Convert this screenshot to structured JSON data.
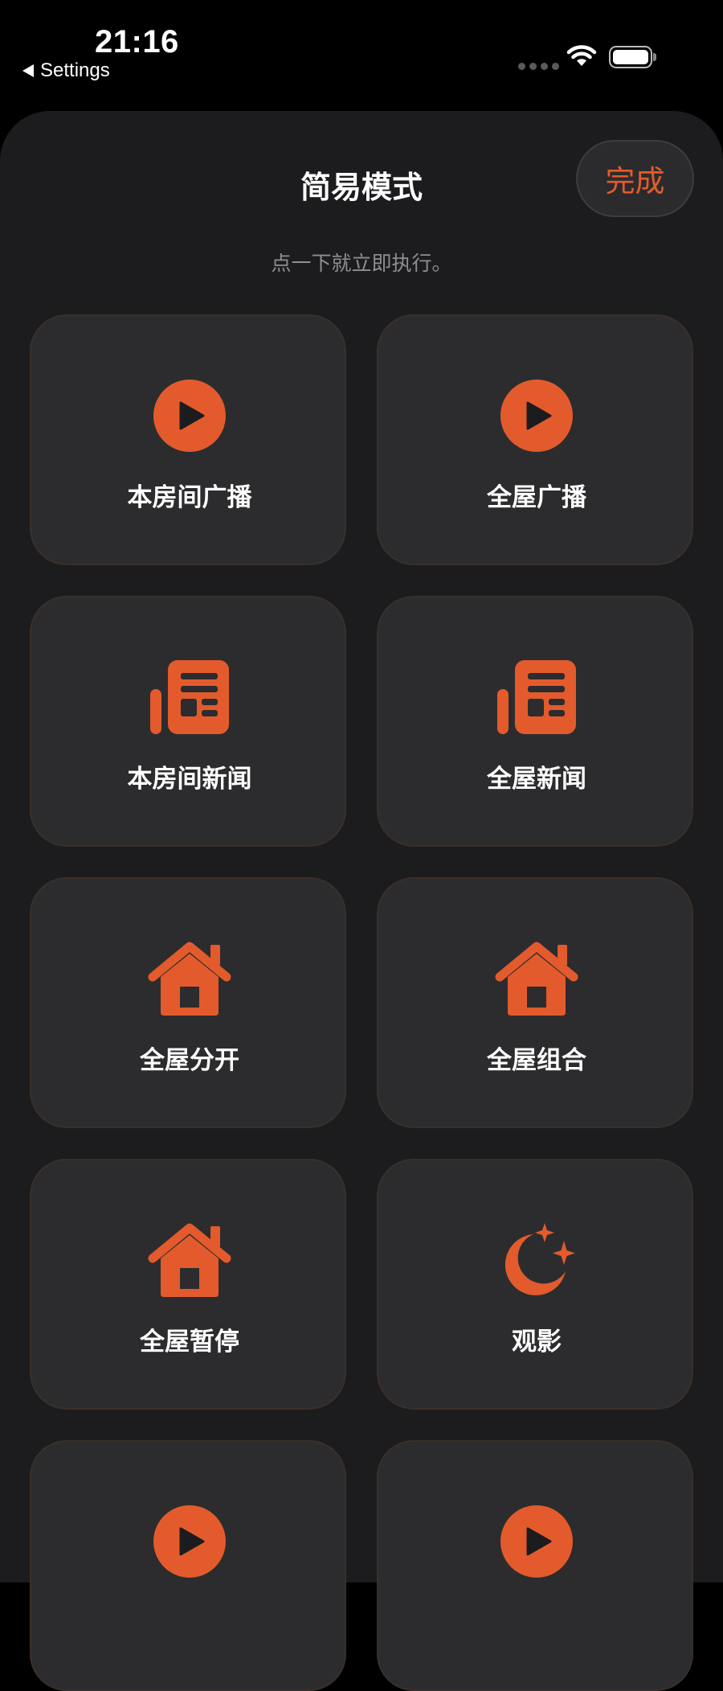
{
  "status_bar": {
    "time": "21:16",
    "back_label": "Settings"
  },
  "sheet": {
    "title": "简易模式",
    "done_label": "完成",
    "subtitle": "点一下就立即执行。"
  },
  "accent_color": "#e35b2c",
  "tiles": [
    {
      "label": "本房间广播",
      "icon": "play-circle-icon"
    },
    {
      "label": "全屋广播",
      "icon": "play-circle-icon"
    },
    {
      "label": "本房间新闻",
      "icon": "newspaper-icon"
    },
    {
      "label": "全屋新闻",
      "icon": "newspaper-icon"
    },
    {
      "label": "全屋分开",
      "icon": "house-icon"
    },
    {
      "label": "全屋组合",
      "icon": "house-icon"
    },
    {
      "label": "全屋暂停",
      "icon": "house-icon"
    },
    {
      "label": "观影",
      "icon": "moon-stars-icon"
    },
    {
      "label": "",
      "icon": "play-circle-icon"
    },
    {
      "label": "",
      "icon": "play-circle-icon"
    }
  ]
}
